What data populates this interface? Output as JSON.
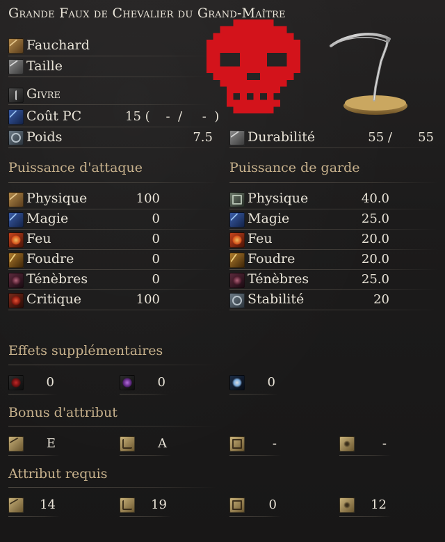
{
  "title": "Grande Faux de Chevalier du Grand-Maître",
  "weapon": {
    "category": "Fauchard",
    "attack_type": "Taille",
    "skill": "Givre",
    "fp_cost": {
      "label": "Coût PC",
      "value": "15 (    -  /     -  )"
    },
    "weight": {
      "label": "Poids",
      "value": "7.5"
    },
    "durability": {
      "label": "Durabilité",
      "current": "55 /",
      "max": "55"
    }
  },
  "attack_power": {
    "title": "Puissance d'attaque",
    "rows": [
      {
        "label": "Physique",
        "value": "100",
        "icon": "physical-icon"
      },
      {
        "label": "Magie",
        "value": "0",
        "icon": "magic-icon"
      },
      {
        "label": "Feu",
        "value": "0",
        "icon": "fire-icon"
      },
      {
        "label": "Foudre",
        "value": "0",
        "icon": "lightning-icon"
      },
      {
        "label": "Ténèbres",
        "value": "0",
        "icon": "dark-icon"
      },
      {
        "label": "Critique",
        "value": "100",
        "icon": "critical-icon"
      }
    ]
  },
  "guard_power": {
    "title": "Puissance de garde",
    "rows": [
      {
        "label": "Physique",
        "value": "40.0",
        "icon": "physical-guard-icon"
      },
      {
        "label": "Magie",
        "value": "25.0",
        "icon": "magic-guard-icon"
      },
      {
        "label": "Feu",
        "value": "20.0",
        "icon": "fire-guard-icon"
      },
      {
        "label": "Foudre",
        "value": "20.0",
        "icon": "lightning-guard-icon"
      },
      {
        "label": "Ténèbres",
        "value": "25.0",
        "icon": "dark-guard-icon"
      },
      {
        "label": "Stabilité",
        "value": "20",
        "icon": "stability-icon"
      }
    ]
  },
  "effects": {
    "title": "Effets supplémentaires",
    "items": [
      {
        "icon": "bleed-icon",
        "value": "0"
      },
      {
        "icon": "poison-icon",
        "value": "0"
      },
      {
        "icon": "frost-icon",
        "value": "0"
      }
    ]
  },
  "scaling": {
    "title": "Bonus d'attribut",
    "items": [
      {
        "icon": "strength-icon",
        "value": "E"
      },
      {
        "icon": "dexterity-icon",
        "value": "A"
      },
      {
        "icon": "intelligence-icon",
        "value": "-"
      },
      {
        "icon": "faith-icon",
        "value": "-"
      }
    ]
  },
  "requirements": {
    "title": "Attribut requis",
    "items": [
      {
        "icon": "strength-icon",
        "value": "14"
      },
      {
        "icon": "dexterity-icon",
        "value": "19"
      },
      {
        "icon": "intelligence-icon",
        "value": "0"
      },
      {
        "icon": "faith-icon",
        "value": "12"
      }
    ]
  },
  "colors": {
    "section_title": "#c7b18c",
    "text": "#e9e4d8",
    "skull": "#d3131b",
    "background": "#1c1b1b"
  }
}
